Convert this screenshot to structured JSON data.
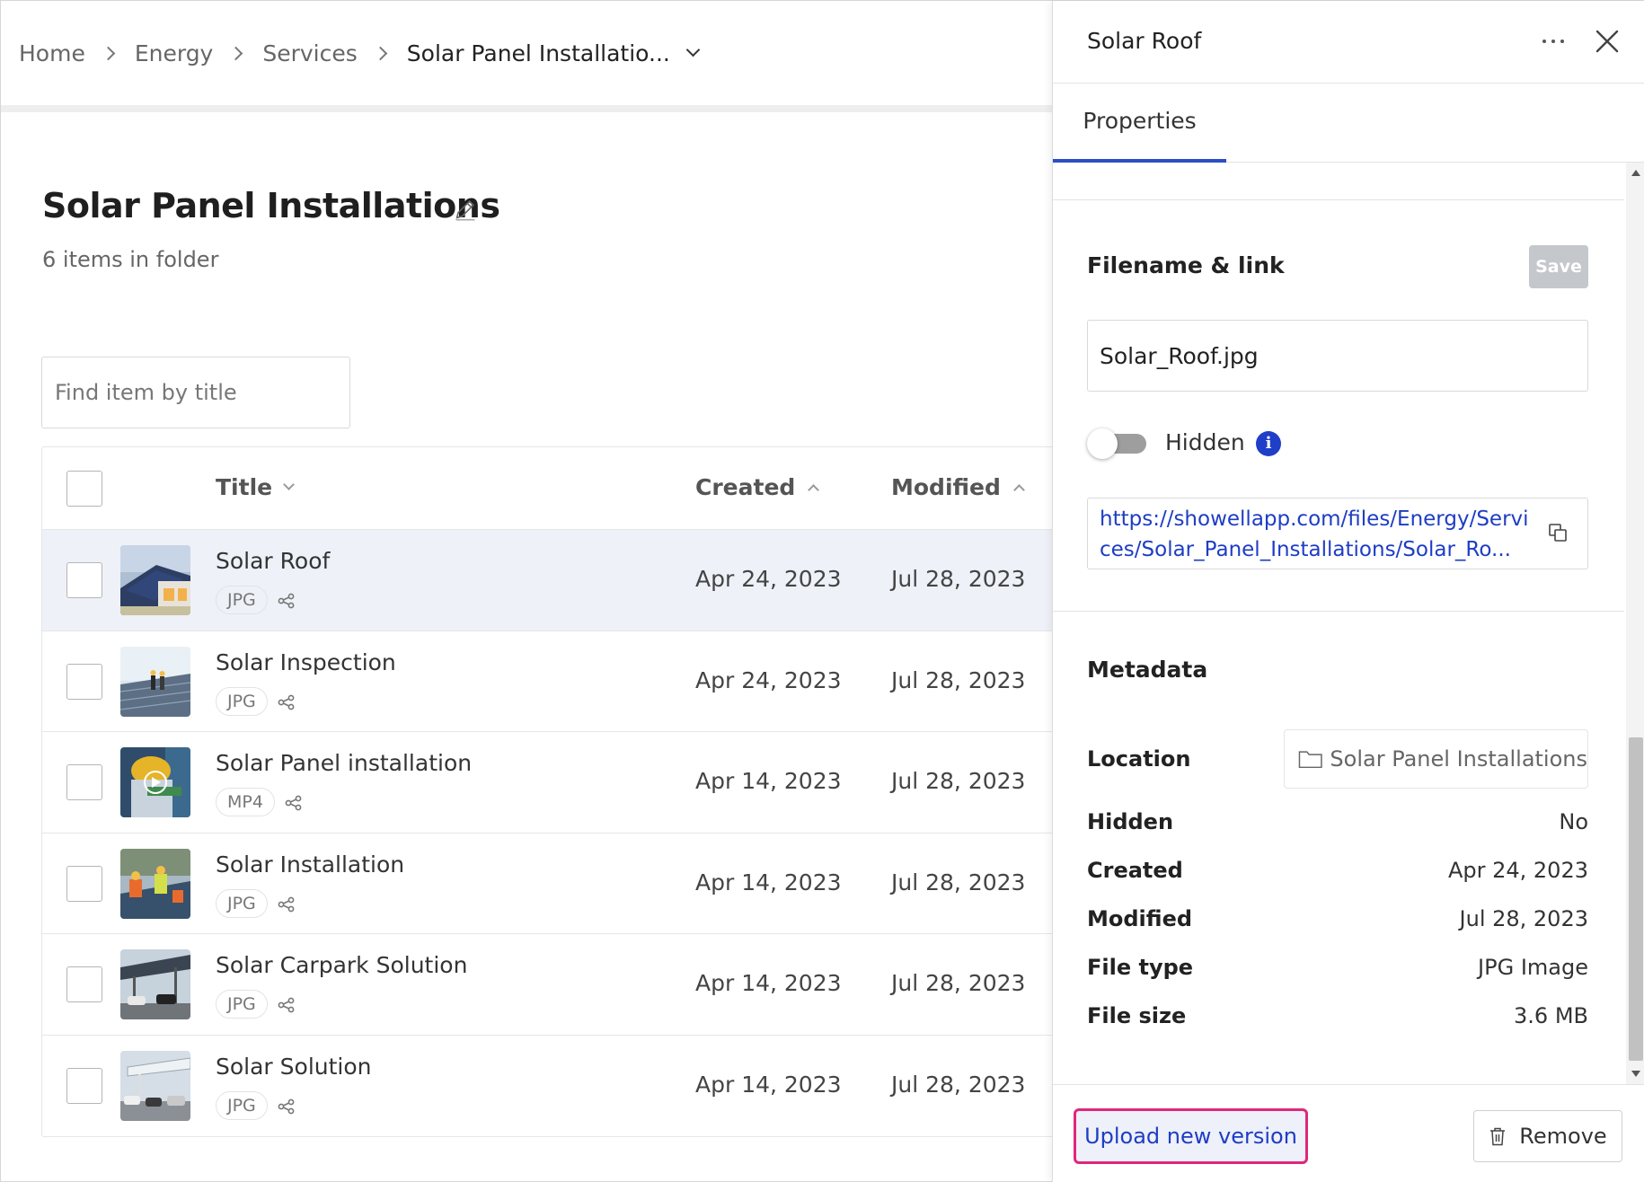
{
  "breadcrumb": {
    "items": [
      "Home",
      "Energy",
      "Services"
    ],
    "current": "Solar Panel Installatio..."
  },
  "folder": {
    "title": "Solar Panel Installations",
    "count_text": "6 items in folder"
  },
  "search": {
    "placeholder": "Find item by title",
    "value": ""
  },
  "table": {
    "columns": {
      "title": "Title",
      "created": "Created",
      "modified": "Modified"
    },
    "rows": [
      {
        "title": "Solar Roof",
        "type": "JPG",
        "created": "Apr 24, 2023",
        "modified": "Jul 28, 2023",
        "thumb": "solar-roof-house-thumbnail"
      },
      {
        "title": "Solar Inspection",
        "type": "JPG",
        "created": "Apr 24, 2023",
        "modified": "Jul 28, 2023",
        "thumb": "solar-field-workers-thumbnail"
      },
      {
        "title": "Solar Panel installation",
        "type": "MP4",
        "created": "Apr 14, 2023",
        "modified": "Jul 28, 2023",
        "thumb": "hardhat-worker-video-thumbnail"
      },
      {
        "title": "Solar Installation",
        "type": "JPG",
        "created": "Apr 14, 2023",
        "modified": "Jul 28, 2023",
        "thumb": "installers-on-roof-thumbnail"
      },
      {
        "title": "Solar Carpark Solution",
        "type": "JPG",
        "created": "Apr 14, 2023",
        "modified": "Jul 28, 2023",
        "thumb": "solar-carport-thumbnail"
      },
      {
        "title": "Solar Solution",
        "type": "JPG",
        "created": "Apr 14, 2023",
        "modified": "Jul 28, 2023",
        "thumb": "solar-carpark-cars-thumbnail"
      }
    ]
  },
  "panel": {
    "title": "Solar Roof",
    "tab": "Properties",
    "filename_section": {
      "title": "Filename & link",
      "save_label": "Save",
      "filename": "Solar_Roof.jpg",
      "hidden_label": "Hidden",
      "hidden_on": false,
      "link": "https://showellapp.com/files/Energy/Services/Solar_Panel_Installations/Solar_Ro..."
    },
    "metadata": {
      "title": "Metadata",
      "location_label": "Location",
      "location_value": "Solar Panel Installations",
      "fields": [
        {
          "label": "Hidden",
          "value": "No"
        },
        {
          "label": "Created",
          "value": "Apr 24, 2023"
        },
        {
          "label": "Modified",
          "value": "Jul 28, 2023"
        },
        {
          "label": "File type",
          "value": "JPG Image"
        },
        {
          "label": "File size",
          "value": "3.6 MB"
        }
      ]
    },
    "footer": {
      "upload_label": "Upload new version",
      "remove_label": "Remove"
    }
  },
  "colors": {
    "accent": "#2a4fc4",
    "link": "#1e3dc4",
    "highlight_border": "#e0277c",
    "selected_row": "#eef1f8",
    "save_disabled": "#c4c7cc"
  }
}
